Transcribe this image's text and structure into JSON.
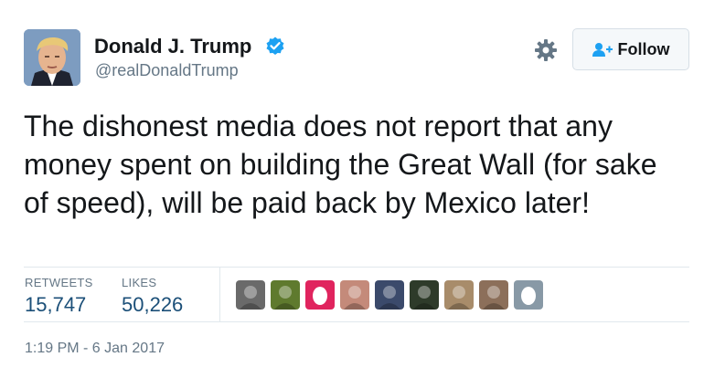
{
  "user": {
    "display_name": "Donald J. Trump",
    "handle": "@realDonaldTrump",
    "verified": true
  },
  "actions": {
    "follow_label": "Follow"
  },
  "tweet": {
    "text": "The dishonest media does not report that any money spent on building the Great Wall (for sake of speed), will be paid back by Mexico later!",
    "timestamp": "1:19 PM - 6 Jan 2017"
  },
  "stats": {
    "retweets_label": "RETWEETS",
    "retweets_value": "15,747",
    "likes_label": "LIKES",
    "likes_value": "50,226"
  },
  "likers": [
    {
      "icon": "avatar-grey-figure",
      "color": "#6a6a6a"
    },
    {
      "icon": "avatar-green-frog",
      "color": "#5f7a2e"
    },
    {
      "icon": "default-egg-avatar",
      "color": "#e0245e"
    },
    {
      "icon": "avatar-two-people",
      "color": "#c48a7a"
    },
    {
      "icon": "avatar-woman",
      "color": "#3b4a6b"
    },
    {
      "icon": "avatar-green-creature",
      "color": "#2e3b2a"
    },
    {
      "icon": "avatar-animal",
      "color": "#a88c6a"
    },
    {
      "icon": "avatar-scene",
      "color": "#8c6f5a"
    },
    {
      "icon": "default-egg-avatar",
      "color": "#8899a6"
    }
  ],
  "colors": {
    "brand_blue": "#1da1f2",
    "stat_value": "#1b4f78",
    "secondary_text": "#657786"
  }
}
